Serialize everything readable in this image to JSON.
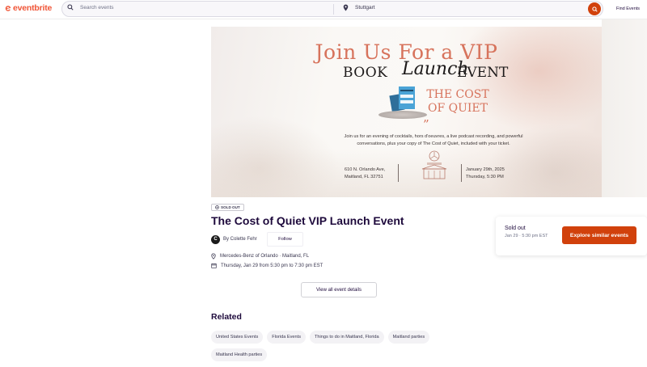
{
  "header": {
    "logo_text": "eventbrite",
    "search_placeholder": "Search events",
    "location_value": "Stuttgart",
    "find_events_label": "Find Events"
  },
  "hero": {
    "headline_line1": "Join Us For a VIP",
    "headline_book": "BOOK",
    "headline_launch": "Launch",
    "headline_event": "EVENT",
    "book_cover_text": "COST QUIET",
    "cost_title": "THE COST OF QUIET",
    "quote_mark": "”",
    "body_text": "Join us for an evening of cocktails, hors d'oeuvres, a live podcast recording, and powerful conversations, plus your copy of The Cost of Quiet, included with your ticket.",
    "address_line1": "610 N. Orlando Ave,",
    "address_line2": "Maitland, FL 32751",
    "date_line1": "January 29th, 2025",
    "date_line2": "Thursday, 5:30 PM"
  },
  "event": {
    "badge": "SOLD OUT",
    "title": "The Cost of Quiet VIP Launch Event",
    "organizer_initial": "C",
    "organizer_by": "By Colette Fehr",
    "follow_label": "Follow",
    "location": "Mercedes-Benz of Orlando · Maitland, FL",
    "datetime": "Thursday, Jan 29 from 5:30 pm to 7:30 pm EST",
    "view_details_label": "View all event details"
  },
  "ticket_card": {
    "status": "Sold out",
    "date_line": "Jan 29 · 5:30 pm EST",
    "explore_label": "Explore similar events"
  },
  "related": {
    "title": "Related",
    "tags": [
      "United States Events",
      "Florida Events",
      "Things to do in Maitland, Florida",
      "Maitland parties",
      "Maitland Health parties"
    ]
  },
  "colors": {
    "brand": "#f05537",
    "accent": "#d1410c",
    "headline_rose": "#d7735c",
    "text": "#1e0a3c"
  }
}
